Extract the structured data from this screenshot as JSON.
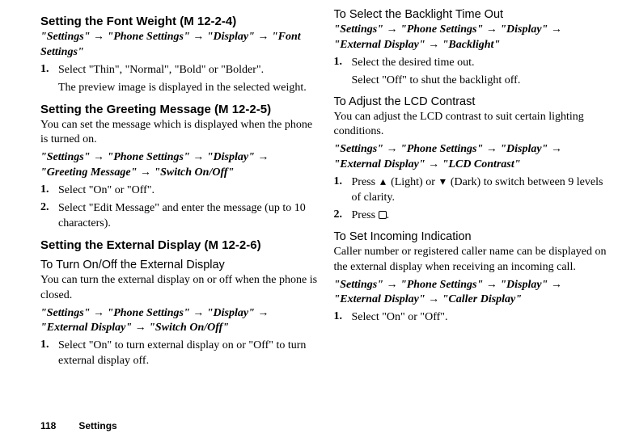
{
  "col1": {
    "sec1": {
      "title": "Setting the Font Weight",
      "mref": " (M 12-2-4)",
      "path": "\"Settings\" → \"Phone Settings\" → \"Display\" → \"Font Settings\"",
      "step1": "Select \"Thin\", \"Normal\", \"Bold\" or \"Bolder\".",
      "step1b": "The preview image is displayed in the selected weight."
    },
    "sec2": {
      "title": "Setting the Greeting Message",
      "mref": " (M 12-2-5)",
      "intro": "You can set the message which is displayed when the phone is turned on.",
      "path": "\"Settings\" → \"Phone Settings\" → \"Display\" → \"Greeting Message\" → \"Switch On/Off\"",
      "step1": "Select \"On\" or \"Off\".",
      "step2": "Select \"Edit Message\" and enter the message (up to 10 characters)."
    },
    "sec3": {
      "title": "Setting the External Display",
      "mref": " (M 12-2-6)",
      "sub1_title": "To Turn On/Off the External Display",
      "sub1_intro": "You can turn the external display on or off when the phone is closed.",
      "sub1_path": "\"Settings\" → \"Phone Settings\" → \"Display\" → \"External Display\" → \"Switch On/Off\"",
      "sub1_step1": "Select \"On\" to turn external display on or \"Off\" to turn external display off."
    }
  },
  "col2": {
    "sub2_title": "To Select the Backlight Time Out",
    "sub2_path": "\"Settings\" → \"Phone Settings\" → \"Display\" → \"External Display\" → \"Backlight\"",
    "sub2_step1": "Select the desired time out.",
    "sub2_step1b": "Select \"Off\" to shut the backlight off.",
    "sub3_title": "To Adjust the LCD Contrast",
    "sub3_intro": "You can adjust the LCD contrast to suit certain lighting conditions.",
    "sub3_path": "\"Settings\" → \"Phone Settings\" → \"Display\" → \"External Display\" → \"LCD Contrast\"",
    "sub3_step1_a": "Press ",
    "sub3_step1_b": " (Light) or ",
    "sub3_step1_c": " (Dark) to switch between 9 levels of clarity.",
    "sub3_step2_a": "Press ",
    "sub3_step2_b": ".",
    "sub4_title": "To Set Incoming Indication",
    "sub4_intro": "Caller number or registered caller name can be displayed on the external display when receiving an incoming call.",
    "sub4_path": "\"Settings\" → \"Phone Settings\" → \"Display\" → \"External Display\" → \"Caller Display\"",
    "sub4_step1": "Select \"On\" or \"Off\"."
  },
  "footer": {
    "page": "118",
    "section": "Settings"
  }
}
